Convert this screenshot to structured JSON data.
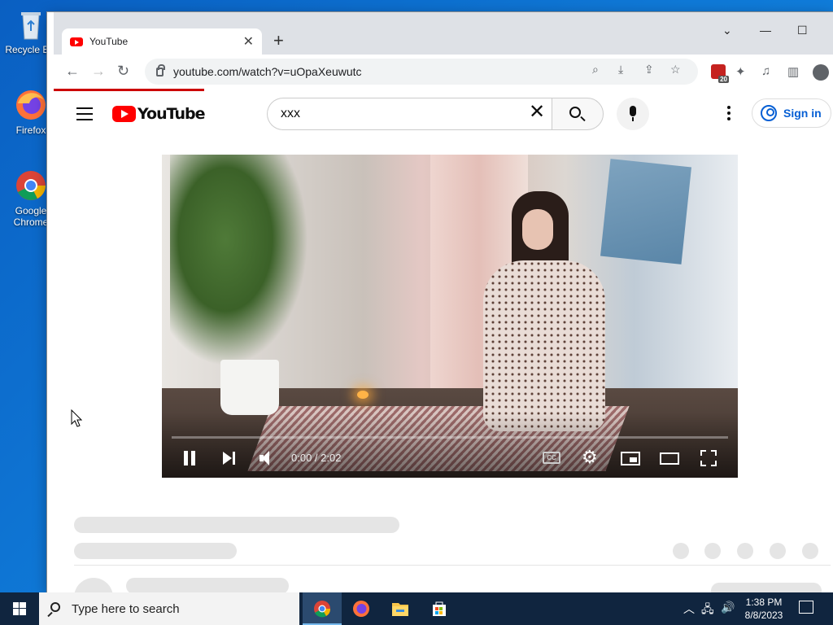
{
  "desktop": {
    "icons": [
      {
        "label": "Recycle Bin"
      },
      {
        "label": "Firefox"
      },
      {
        "label": "Google Chrome"
      }
    ]
  },
  "browser": {
    "tab": {
      "title": "YouTube"
    },
    "address": "youtube.com/watch?v=uOpaXeuwutc",
    "extension_badge": "20",
    "colors": {
      "tabstrip": "#dee1e6",
      "load_bar": "#cc0000"
    }
  },
  "youtube": {
    "logo_text": "YouTube",
    "search_value": "xxx",
    "sign_in": "Sign in",
    "player": {
      "time": "0:00 / 2:02",
      "progress_fraction": 0.0,
      "cc_label": "CC",
      "state": "playing"
    },
    "colors": {
      "brand": "#ff0000",
      "link": "#065fd4"
    }
  },
  "taskbar": {
    "search_placeholder": "Type here to search",
    "clock_time": "1:38 PM",
    "clock_date": "8/8/2023",
    "apps": [
      "chrome-icon",
      "firefox-icon",
      "file-explorer-icon",
      "store-icon"
    ]
  }
}
